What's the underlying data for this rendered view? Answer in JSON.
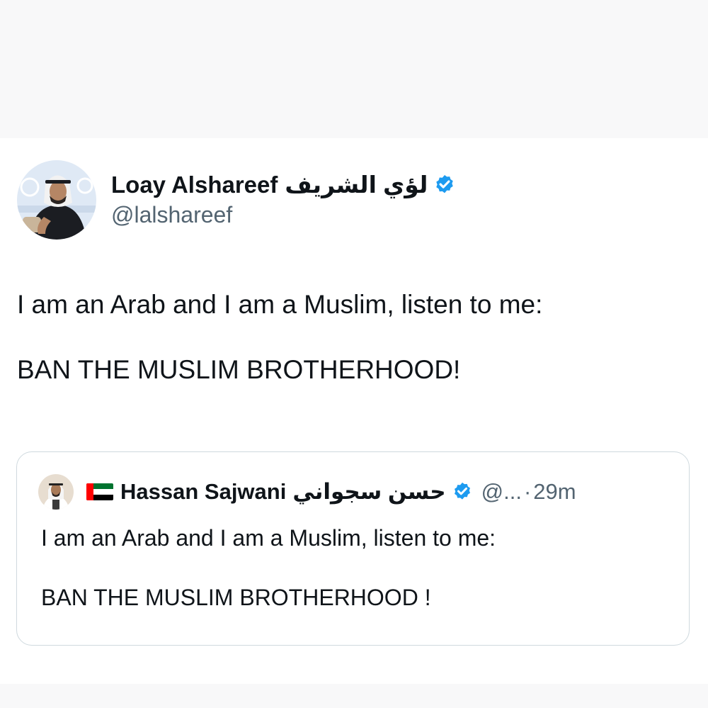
{
  "tweet": {
    "author_name": "Loay Alshareef",
    "author_name_arabic": "لؤي الشريف",
    "author_handle": "@lalshareef",
    "lines": [
      "I am an Arab and I am a Muslim, listen to me:",
      "BAN THE MUSLIM BROTHERHOOD!"
    ]
  },
  "quoted_tweet": {
    "author_name": "Hassan Sajwani",
    "author_name_arabic": "حسن سجواني",
    "author_handle": "@...",
    "separator": "·",
    "time": "29m",
    "lines": [
      "I am an Arab and I am a Muslim, listen to me:",
      "BAN THE MUSLIM BROTHERHOOD !"
    ]
  },
  "icons": {
    "verified": "verified-badge-icon",
    "flag": "uae-flag-icon"
  },
  "colors": {
    "verified_blue": "#1d9bf0",
    "text_primary": "#0f1419",
    "text_secondary": "#536471",
    "card_border": "#cfd9de",
    "page_background": "#f8f8f9",
    "card_background": "#ffffff"
  }
}
